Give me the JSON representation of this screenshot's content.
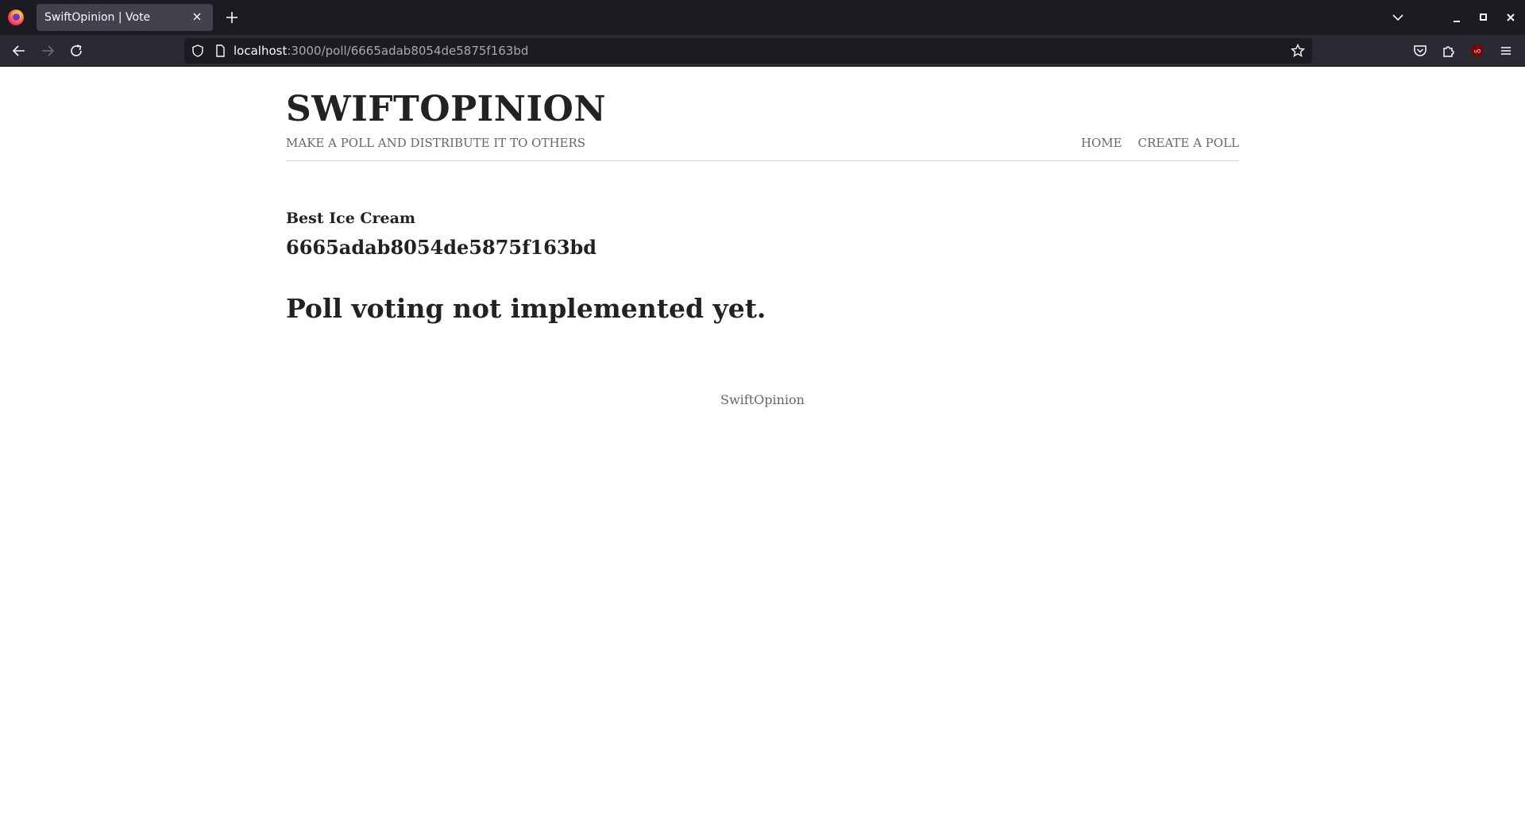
{
  "browser": {
    "tab_title": "SwiftOpinion | Vote",
    "url_host": "localhost",
    "url_path": ":3000/poll/6665adab8054de5875f163bd",
    "colors": {
      "tabbar": "#1c1b22",
      "toolbar": "#2b2a33",
      "active_tab": "#42414d"
    },
    "icons": [
      "firefox-logo-icon",
      "close-icon",
      "plus-icon",
      "chevron-down-icon",
      "minimize-icon",
      "maximize-icon",
      "window-close-icon",
      "back-arrow-icon",
      "forward-arrow-icon",
      "reload-icon",
      "shield-icon",
      "page-icon",
      "star-icon",
      "pocket-icon",
      "extensions-icon",
      "ublock-icon",
      "hamburger-menu-icon"
    ]
  },
  "site": {
    "title": "SWIFTOPINION",
    "tagline": "MAKE A POLL AND DISTRIBUTE IT TO OTHERS",
    "nav": [
      {
        "label": "HOME"
      },
      {
        "label": "CREATE A POLL"
      }
    ],
    "footer": "SwiftOpinion"
  },
  "poll": {
    "name": "Best Ice Cream",
    "id": "6665adab8054de5875f163bd",
    "status_message": "Poll voting not implemented yet."
  }
}
